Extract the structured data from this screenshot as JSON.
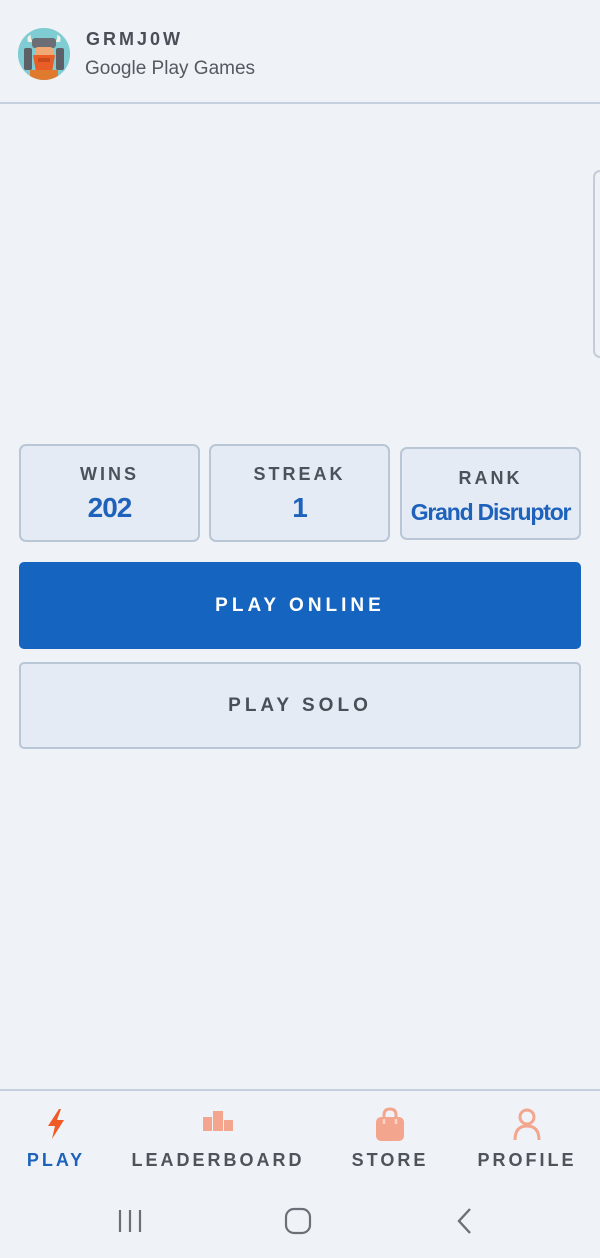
{
  "header": {
    "username": "GRMJ0W",
    "provider": "Google Play Games",
    "avatar_icon": "viking-avatar-icon"
  },
  "stats": [
    {
      "label": "WINS",
      "value": "202"
    },
    {
      "label": "STREAK",
      "value": "1"
    },
    {
      "label": "RANK",
      "value": "Grand Disruptor"
    }
  ],
  "buttons": {
    "play_online": "PLAY ONLINE",
    "play_solo": "PLAY SOLO"
  },
  "bottom_nav": [
    {
      "label": "PLAY",
      "icon": "lightning-icon",
      "active": true
    },
    {
      "label": "LEADERBOARD",
      "icon": "podium-icon",
      "active": false
    },
    {
      "label": "STORE",
      "icon": "shopping-bag-icon",
      "active": false
    },
    {
      "label": "PROFILE",
      "icon": "person-icon",
      "active": false
    }
  ],
  "system_nav": {
    "recents_icon": "recents-icon",
    "home_icon": "home-icon",
    "back_icon": "back-icon"
  },
  "colors": {
    "background": "#eff3f8",
    "accent_blue": "#1565c0",
    "stat_value_blue": "#1e62bb",
    "nav_icon_active": "#f05a24",
    "nav_icon_inactive": "#f4a58e"
  }
}
